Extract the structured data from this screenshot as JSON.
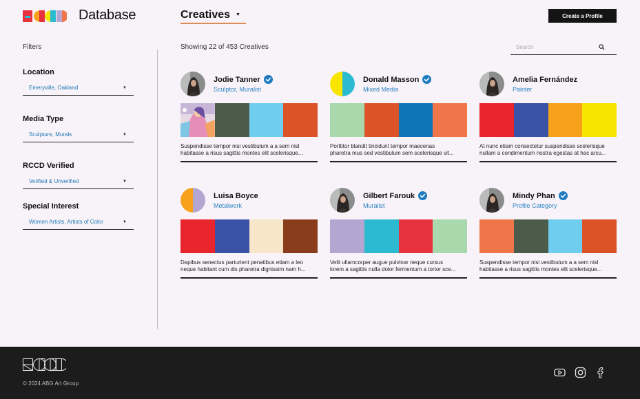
{
  "app": {
    "title": "Database"
  },
  "colors": {
    "accent_blue": "#1f78b4",
    "verified_blue": "#1e7bbf",
    "underline_orange": "#e08a53",
    "footer_bg": "#1c1c1c"
  },
  "header": {
    "section_dropdown": "Creatives",
    "create_button": "Create a Profile"
  },
  "sidebar": {
    "title": "Filters",
    "filters": [
      {
        "label": "Location",
        "value": "Emeryville, Oakland"
      },
      {
        "label": "Media Type",
        "value": "Sculpture, Murals"
      },
      {
        "label": "RCCD Verified",
        "value": "Verified & Unverified"
      },
      {
        "label": "Special Interest",
        "value": "Women Artists, Artists of Color"
      }
    ]
  },
  "main": {
    "showing": "Showing 22 of 453 Creatives",
    "search_placeholder": "Search",
    "cards": [
      {
        "name": "Jodie Tanner",
        "role": "Sculptor, Muralist",
        "verified": true,
        "avatar": "photo",
        "swatches": [
          "image",
          "#4c5c4b",
          "#6fcdf0",
          "#db5327"
        ],
        "desc": [
          "Suspendisse tempor nisi vestibulum a a sem nisl",
          "habitasse a risus sagittis montes elit scelerisque..."
        ]
      },
      {
        "name": "Donald Masson",
        "role": "Mixed Media",
        "verified": true,
        "avatar": "yellow-cyan",
        "swatches": [
          "#a8d8ab",
          "#db5327",
          "#0e75b8",
          "#f07548"
        ],
        "desc": [
          "Porttitor blandit tincidunt tempor maecenas",
          "pharetra mus sed vestibulum sem scelerisque vit..."
        ]
      },
      {
        "name": "Amelia Fernández",
        "role": "Painter",
        "verified": false,
        "avatar": "photo",
        "swatches": [
          "#e8252d",
          "#3a52a6",
          "#f7a21b",
          "#f7e500"
        ],
        "desc": [
          "At nunc etiam consectetur suspendisse scelerisque",
          "nullam a condimentum nostra egestas at hac arcu..."
        ]
      },
      {
        "name": "Luisa Boyce",
        "role": "Metalwork",
        "verified": false,
        "avatar": "orange-lavender",
        "swatches": [
          "#e8252d",
          "#3a52a6",
          "#f7e6c8",
          "#8a3d1a"
        ],
        "desc": [
          "Dapibus senectus parturient penatibus etiam a leo",
          "neque habitant cum dis pharetra dignissim nam h..."
        ]
      },
      {
        "name": "Gilbert Farouk",
        "role": "Muralist",
        "verified": true,
        "avatar": "photo",
        "swatches": [
          "#b3a6d1",
          "#2bbad0",
          "#e8313f",
          "#a8d8ab"
        ],
        "desc": [
          "Velit ullamcorper augue pulvinar neque cursus",
          "lorem a sagittis nulla dolor fermentum a tortor sce..."
        ]
      },
      {
        "name": "Mindy Phan",
        "role": "Profile Category",
        "verified": true,
        "avatar": "photo",
        "swatches": [
          "#f07548",
          "#4c5c4b",
          "#6fcdf0",
          "#db5327"
        ],
        "desc": [
          "Suspendisse tempor nisi vestibulum a a sem nisl",
          "habitasse a risus sagittis montes elit scelerisque..."
        ]
      }
    ]
  },
  "footer": {
    "copyright": "© 2024 ABG Art Group",
    "social": [
      "youtube-icon",
      "instagram-icon",
      "facebook-icon"
    ]
  }
}
